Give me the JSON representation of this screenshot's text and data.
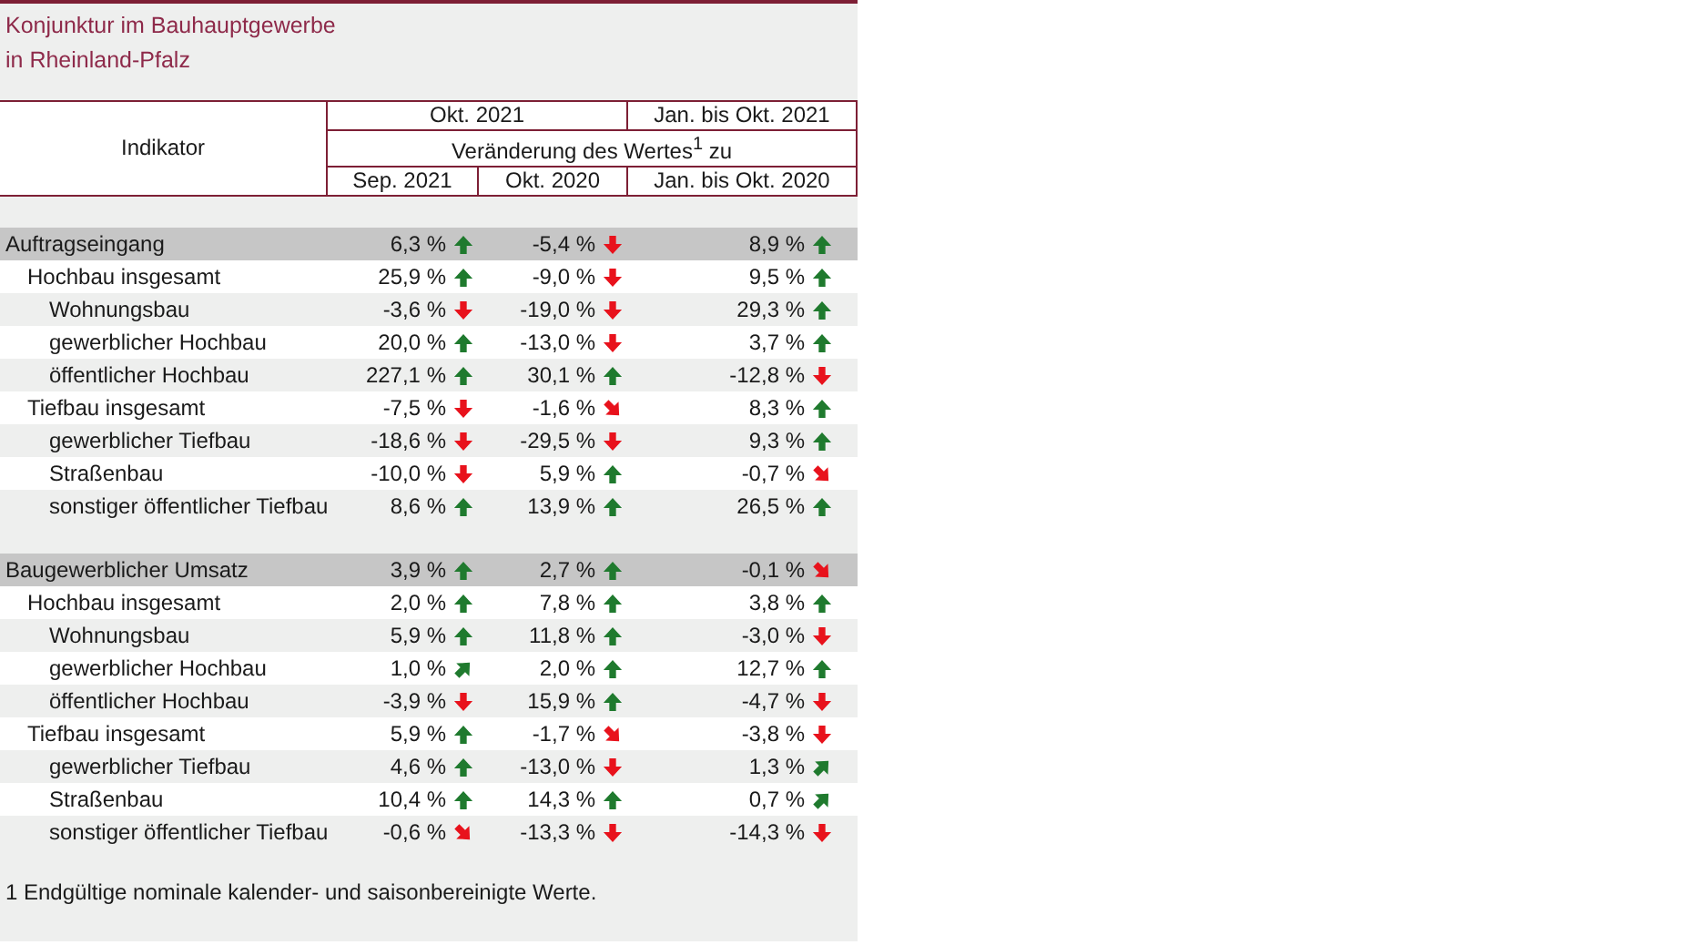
{
  "title": [
    "Konjunktur im Bauhauptgewerbe",
    "in Rheinland-Pfalz"
  ],
  "header": {
    "indicator": "Indikator",
    "period_current": "Okt. 2021",
    "period_cumulative": "Jan. bis Okt. 2021",
    "change_label": "Veränderung des Wertes$^{1}$ zu",
    "compare": [
      "Sep. 2021",
      "Okt. 2020",
      "Jan. bis Okt. 2020"
    ]
  },
  "sections": [
    {
      "label": "Auftragseingang",
      "cells": [
        {
          "value": "6,3 %",
          "kind": "up"
        },
        {
          "value": "-5,4 %",
          "kind": "down"
        },
        {
          "value": "8,9 %",
          "kind": "up"
        }
      ],
      "children": [
        {
          "label": "Hochbau insgesamt",
          "cells": [
            {
              "value": "25,9 %",
              "kind": "up"
            },
            {
              "value": "-9,0 %",
              "kind": "down"
            },
            {
              "value": "9,5 %",
              "kind": "up"
            }
          ],
          "children": [
            {
              "label": "Wohnungsbau",
              "cells": [
                {
                  "value": "-3,6 %",
                  "kind": "down"
                },
                {
                  "value": "-19,0 %",
                  "kind": "down"
                },
                {
                  "value": "29,3 %",
                  "kind": "up"
                }
              ]
            },
            {
              "label": "gewerblicher Hochbau",
              "cells": [
                {
                  "value": "20,0 %",
                  "kind": "up"
                },
                {
                  "value": "-13,0 %",
                  "kind": "down"
                },
                {
                  "value": "3,7 %",
                  "kind": "up"
                }
              ]
            },
            {
              "label": "öffentlicher Hochbau",
              "cells": [
                {
                  "value": "227,1 %",
                  "kind": "up"
                },
                {
                  "value": "30,1 %",
                  "kind": "up"
                },
                {
                  "value": "-12,8 %",
                  "kind": "down"
                }
              ]
            }
          ]
        },
        {
          "label": "Tiefbau insgesamt",
          "cells": [
            {
              "value": "-7,5 %",
              "kind": "down"
            },
            {
              "value": "-1,6 %",
              "kind": "down_right"
            },
            {
              "value": "8,3 %",
              "kind": "up"
            }
          ],
          "children": [
            {
              "label": "gewerblicher Tiefbau",
              "cells": [
                {
                  "value": "-18,6 %",
                  "kind": "down"
                },
                {
                  "value": "-29,5 %",
                  "kind": "down"
                },
                {
                  "value": "9,3 %",
                  "kind": "up"
                }
              ]
            },
            {
              "label": "Straßenbau",
              "cells": [
                {
                  "value": "-10,0 %",
                  "kind": "down"
                },
                {
                  "value": "5,9 %",
                  "kind": "up"
                },
                {
                  "value": "-0,7 %",
                  "kind": "down_right"
                }
              ]
            },
            {
              "label": "sonstiger öffentlicher Tiefbau",
              "cells": [
                {
                  "value": "8,6 %",
                  "kind": "up"
                },
                {
                  "value": "13,9 %",
                  "kind": "up"
                },
                {
                  "value": "26,5 %",
                  "kind": "up"
                }
              ]
            }
          ]
        }
      ]
    },
    {
      "label": "Baugewerblicher Umsatz",
      "cells": [
        {
          "value": "3,9 %",
          "kind": "up"
        },
        {
          "value": "2,7 %",
          "kind": "up"
        },
        {
          "value": "-0,1 %",
          "kind": "down_right"
        }
      ],
      "children": [
        {
          "label": "Hochbau insgesamt",
          "cells": [
            {
              "value": "2,0 %",
              "kind": "up"
            },
            {
              "value": "7,8 %",
              "kind": "up"
            },
            {
              "value": "3,8 %",
              "kind": "up"
            }
          ],
          "children": [
            {
              "label": "Wohnungsbau",
              "cells": [
                {
                  "value": "5,9 %",
                  "kind": "up"
                },
                {
                  "value": "11,8 %",
                  "kind": "up"
                },
                {
                  "value": "-3,0 %",
                  "kind": "down"
                }
              ]
            },
            {
              "label": "gewerblicher Hochbau",
              "cells": [
                {
                  "value": "1,0 %",
                  "kind": "up_right"
                },
                {
                  "value": "2,0 %",
                  "kind": "up"
                },
                {
                  "value": "12,7 %",
                  "kind": "up"
                }
              ]
            },
            {
              "label": "öffentlicher Hochbau",
              "cells": [
                {
                  "value": "-3,9 %",
                  "kind": "down"
                },
                {
                  "value": "15,9 %",
                  "kind": "up"
                },
                {
                  "value": "-4,7 %",
                  "kind": "down"
                }
              ]
            }
          ]
        },
        {
          "label": "Tiefbau insgesamt",
          "cells": [
            {
              "value": "5,9 %",
              "kind": "up"
            },
            {
              "value": "-1,7 %",
              "kind": "down_right"
            },
            {
              "value": "-3,8 %",
              "kind": "down"
            }
          ],
          "children": [
            {
              "label": "gewerblicher Tiefbau",
              "cells": [
                {
                  "value": "4,6 %",
                  "kind": "up"
                },
                {
                  "value": "-13,0 %",
                  "kind": "down"
                },
                {
                  "value": "1,3 %",
                  "kind": "up_right"
                }
              ]
            },
            {
              "label": "Straßenbau",
              "cells": [
                {
                  "value": "10,4 %",
                  "kind": "up"
                },
                {
                  "value": "14,3 %",
                  "kind": "up"
                },
                {
                  "value": "0,7 %",
                  "kind": "up_right"
                }
              ]
            },
            {
              "label": "sonstiger öffentlicher Tiefbau",
              "cells": [
                {
                  "value": "-0,6 %",
                  "kind": "down_right"
                },
                {
                  "value": "-13,3 %",
                  "kind": "down"
                },
                {
                  "value": "-14,3 %",
                  "kind": "down"
                }
              ]
            }
          ]
        }
      ]
    }
  ],
  "footnote": "1 Endgültige nominale kalender- und saisonbereinigte Werte."
}
